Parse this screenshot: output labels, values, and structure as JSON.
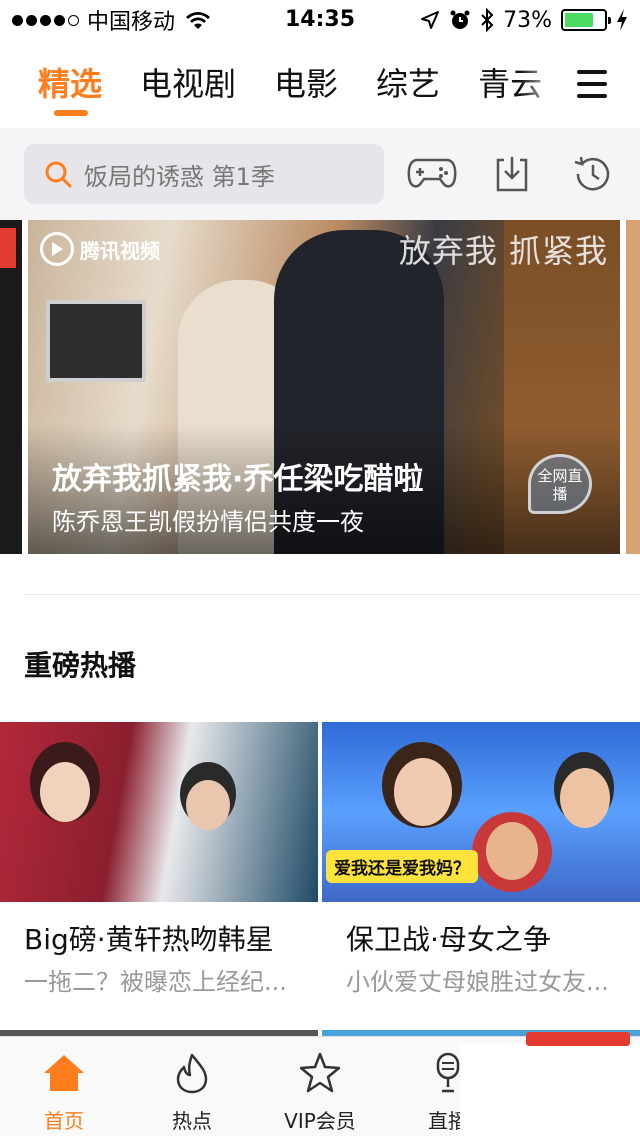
{
  "status_bar": {
    "carrier": "中国移动",
    "time": "14:35",
    "battery_percent": "73%",
    "battery_level": 0.73
  },
  "nav": {
    "tabs": [
      "精选",
      "电视剧",
      "电影",
      "综艺",
      "青云"
    ],
    "active_index": 0
  },
  "search": {
    "placeholder": "饭局的诱惑 第1季"
  },
  "toolbar_icons": [
    "gamepad-icon",
    "download-icon",
    "history-icon"
  ],
  "banner": {
    "logo_text": "腾讯视频",
    "brand_text": "放弃我 抓紧我",
    "title": "放弃我抓紧我·乔任梁吃醋啦",
    "subtitle": "陈乔恩王凯假扮情侣共度一夜",
    "live_badge": "全网直播"
  },
  "section": {
    "title": "重磅热播"
  },
  "cards": [
    {
      "title": "Big磅·黄轩热吻韩星",
      "subtitle": "一拖二？被曝恋上经纪..."
    },
    {
      "title": "保卫战·母女之争",
      "subtitle": "小伙爱丈母娘胜过女友...",
      "caption": "爱我还是爱我妈？"
    }
  ],
  "tab_bar": {
    "items": [
      {
        "label": "首页",
        "icon": "home-icon"
      },
      {
        "label": "热点",
        "icon": "flame-icon"
      },
      {
        "label": "VIP会员",
        "icon": "vip-star-icon"
      },
      {
        "label": "直播",
        "icon": "microphone-icon"
      }
    ],
    "active_index": 0
  },
  "colors": {
    "accent": "#ff7d1c",
    "live_battery": "#4cd964"
  }
}
